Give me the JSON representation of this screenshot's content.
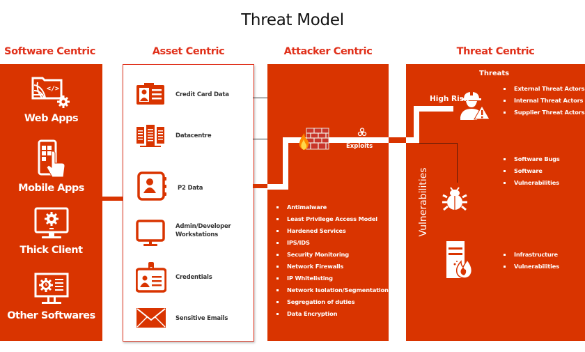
{
  "title": "Threat Model",
  "columns": {
    "software": {
      "heading": "Software Centric",
      "items": [
        {
          "label": "Web Apps",
          "icon": "web-app-icon"
        },
        {
          "label": "Mobile Apps",
          "icon": "mobile-touch-icon"
        },
        {
          "label": "Thick Client",
          "icon": "monitor-gear-icon"
        },
        {
          "label": "Other Softwares",
          "icon": "monitor-settings-icon"
        }
      ]
    },
    "asset": {
      "heading": "Asset Centric",
      "items": [
        {
          "label": "Credit Card Data",
          "icon": "id-card-icon"
        },
        {
          "label": "Datacentre",
          "icon": "server-rack-icon"
        },
        {
          "label": "P2 Data",
          "icon": "contact-book-icon"
        },
        {
          "label": "Admin/Developer Workstations",
          "line1": "Admin/Developer",
          "line2": "Workstations",
          "icon": "monitor-icon"
        },
        {
          "label": "Credentials",
          "icon": "badge-icon"
        },
        {
          "label": "Sensitive Emails",
          "icon": "envelope-icon"
        }
      ]
    },
    "attacker": {
      "heading": "Attacker Centric",
      "exploits_label": "Exploits",
      "controls": [
        "Antimalware",
        "Least Privilege Access Model",
        "Hardened Services",
        "IPS/IDS",
        "Security Monitoring",
        "Network Firewalls",
        "IP Whitelisting",
        "Network Isolation/Segmentation",
        "Segregation of duties",
        "Data Encryption"
      ]
    },
    "threat": {
      "heading": "Threat Centric",
      "threats_title": "Threats",
      "high_risk_label": "High Risk",
      "vulnerabilities_label": "Vulnerabilities",
      "threat_actors": [
        "External Threat Actors",
        "Internal Threat Actors",
        "Supplier Threat Actors"
      ],
      "software_vulns": [
        "Software Bugs",
        "Software",
        "Vulnerabilities"
      ],
      "infra_vulns": [
        "Infrastructure",
        "Vulnerabilities"
      ]
    }
  },
  "colors": {
    "primary": "#d93400",
    "heading": "#e0301a",
    "title": "#111111"
  }
}
